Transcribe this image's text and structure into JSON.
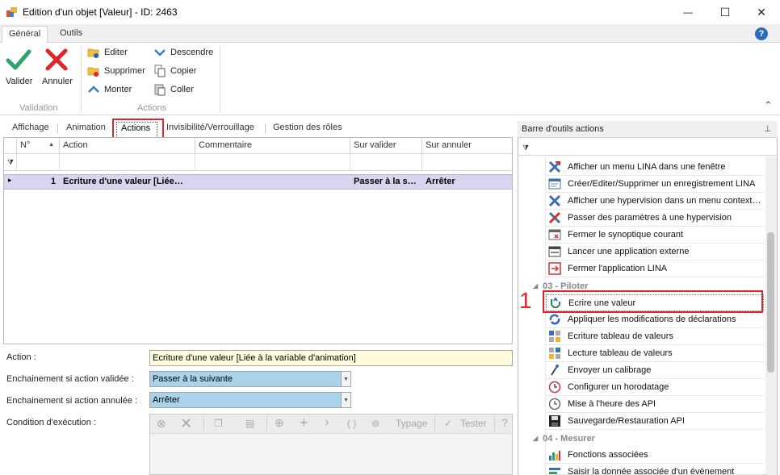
{
  "window": {
    "title": "Edition d'un objet [Valeur] - ID: 2463",
    "minimize_glyph": "—",
    "maximize_glyph": "☐",
    "close_glyph": "✕"
  },
  "ribbon": {
    "tabs": [
      {
        "label": "Général"
      },
      {
        "label": "Outils"
      }
    ],
    "help_glyph": "?",
    "collapse_glyph": "⌃",
    "validation": {
      "group_label": "Validation",
      "valider_label": "Valider",
      "annuler_label": "Annuler"
    },
    "actions": {
      "group_label": "Actions",
      "editer": "Editer",
      "supprimer": "Supprimer",
      "monter": "Monter",
      "descendre": "Descendre",
      "copier": "Copier",
      "coller": "Coller"
    }
  },
  "content_tabs": [
    {
      "label": "Affichage"
    },
    {
      "label": "Animation"
    },
    {
      "label": "Actions"
    },
    {
      "label": "Invisibilité/Verrouillage"
    },
    {
      "label": "Gestion des rôles"
    }
  ],
  "grid": {
    "columns": [
      "N°",
      "Action",
      "Commentaire",
      "Sur valider",
      "Sur annuler"
    ],
    "sort_glyph": "▲",
    "filter_glyph": "⧩",
    "row_indicator": "▸",
    "rows": [
      {
        "num": "1",
        "action": "Ecriture d'une valeur [Liée…",
        "commentaire": "",
        "sur_valider": "Passer à la s…",
        "sur_annuler": "Arrêter"
      }
    ]
  },
  "properties": {
    "action_label": "Action :",
    "action_value": "Ecriture d'une valeur [Liée à la variable d'animation]",
    "valid_label": "Enchainement si action validée :",
    "valid_value": "Passer à la suivante",
    "cancel_label": "Enchainement si action annulée :",
    "cancel_value": "Arrêter",
    "condition_label": "Condition d'exécution :",
    "toolbar": {
      "parens": "( )",
      "typage": "Typage",
      "tester": "Tester"
    }
  },
  "toolbox": {
    "title": "Barre d'outils actions",
    "pin_glyph": "⊥",
    "filter_glyph": "⧩",
    "items_top": [
      {
        "label": "Afficher un menu LINA dans une fenêtre",
        "icon": "menu-window-icon"
      },
      {
        "label": "Créer/Editer/Supprimer un enregistrement LINA",
        "icon": "record-edit-icon"
      },
      {
        "label": "Afficher une hypervision dans un menu context…",
        "icon": "hypervision-context-icon"
      },
      {
        "label": "Passer des paramètres à une hypervision",
        "icon": "hypervision-params-icon"
      },
      {
        "label": "Fermer le synoptique courant",
        "icon": "close-synoptic-icon"
      },
      {
        "label": "Lancer une application externe",
        "icon": "launch-app-icon"
      },
      {
        "label": "Fermer l'application LINA",
        "icon": "exit-app-icon"
      }
    ],
    "group_piloter": "03 - Piloter",
    "items_piloter": [
      {
        "label": "Ecrire une valeur",
        "icon": "write-value-icon"
      },
      {
        "label": "Appliquer les modifications de déclarations",
        "icon": "apply-changes-icon"
      },
      {
        "label": "Ecriture tableau de valeurs",
        "icon": "write-array-icon"
      },
      {
        "label": "Lecture tableau de valeurs",
        "icon": "read-array-icon"
      },
      {
        "label": "Envoyer un calibrage",
        "icon": "calibration-icon"
      },
      {
        "label": "Configurer un horodatage",
        "icon": "timestamp-icon"
      },
      {
        "label": "Mise à l'heure des API",
        "icon": "clock-sync-icon"
      },
      {
        "label": "Sauvegarde/Restauration API",
        "icon": "save-restore-icon"
      }
    ],
    "group_mesurer": "04 - Mesurer",
    "items_mesurer": [
      {
        "label": "Fonctions associées",
        "icon": "functions-icon"
      },
      {
        "label": "Saisir la donnée associée d'un évènement",
        "icon": "event-data-icon"
      }
    ],
    "marker": "1"
  },
  "colors": {
    "highlight": "#e0262b",
    "selected_row": "#d7d6ee",
    "action_field": "#fffbdc",
    "combo_field": "#a8d3ea"
  }
}
